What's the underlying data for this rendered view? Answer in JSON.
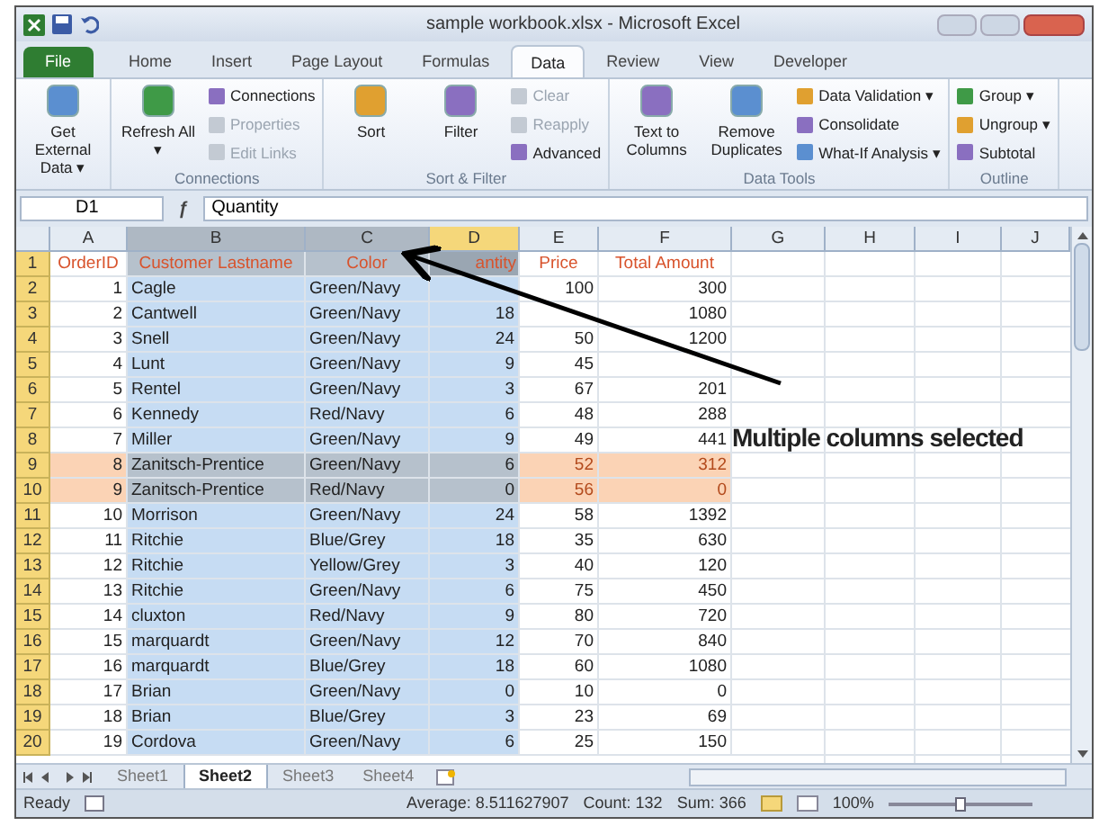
{
  "window": {
    "title": "sample workbook.xlsx - Microsoft Excel"
  },
  "ribbon_tabs": [
    {
      "label": "File",
      "kind": "file",
      "selected": false
    },
    {
      "label": "Home",
      "kind": "tab",
      "selected": false
    },
    {
      "label": "Insert",
      "kind": "tab",
      "selected": false
    },
    {
      "label": "Page Layout",
      "kind": "tab",
      "selected": false
    },
    {
      "label": "Formulas",
      "kind": "tab",
      "selected": false
    },
    {
      "label": "Data",
      "kind": "tab",
      "selected": true
    },
    {
      "label": "Review",
      "kind": "tab",
      "selected": false
    },
    {
      "label": "View",
      "kind": "tab",
      "selected": false
    },
    {
      "label": "Developer",
      "kind": "tab",
      "selected": false
    }
  ],
  "ribbon_groups": [
    {
      "items": [
        {
          "label": "Get External Data ▾",
          "kind": "large",
          "disabled": false
        }
      ]
    },
    {
      "name": "Connections",
      "items": [
        {
          "label": "Refresh All ▾",
          "kind": "large",
          "disabled": false
        },
        {
          "label": "Connections",
          "kind": "small",
          "disabled": false
        },
        {
          "label": "Properties",
          "kind": "small",
          "disabled": true
        },
        {
          "label": "Edit Links",
          "kind": "small",
          "disabled": true
        }
      ]
    },
    {
      "name": "Sort & Filter",
      "items": [
        {
          "label": "Sort",
          "kind": "large",
          "disabled": false
        },
        {
          "label": "Filter",
          "kind": "large",
          "disabled": false
        },
        {
          "label": "Clear",
          "kind": "small",
          "disabled": true
        },
        {
          "label": "Reapply",
          "kind": "small",
          "disabled": true
        },
        {
          "label": "Advanced",
          "kind": "small",
          "disabled": false
        }
      ]
    },
    {
      "name": "Data Tools",
      "items": [
        {
          "label": "Text to Columns",
          "kind": "large",
          "disabled": false
        },
        {
          "label": "Remove Duplicates",
          "kind": "large",
          "disabled": false
        },
        {
          "label": "Data Validation ▾",
          "kind": "small",
          "disabled": false
        },
        {
          "label": "Consolidate",
          "kind": "small",
          "disabled": false
        },
        {
          "label": "What-If Analysis ▾",
          "kind": "small",
          "disabled": false
        }
      ]
    },
    {
      "name": "Outline",
      "items": [
        {
          "label": "Group ▾",
          "kind": "small",
          "disabled": false
        },
        {
          "label": "Ungroup ▾",
          "kind": "small",
          "disabled": false
        },
        {
          "label": "Subtotal",
          "kind": "small",
          "disabled": false
        }
      ]
    }
  ],
  "name_box": "D1",
  "function_button": "ƒ",
  "formula": "Quantity",
  "columns": [
    {
      "label": "A",
      "selected": false,
      "active": false
    },
    {
      "label": "B",
      "selected": true,
      "active": false
    },
    {
      "label": "C",
      "selected": true,
      "active": false
    },
    {
      "label": "D",
      "selected": true,
      "active": true
    },
    {
      "label": "E",
      "selected": false,
      "active": false
    },
    {
      "label": "F",
      "selected": false,
      "active": false
    },
    {
      "label": "G",
      "selected": false,
      "active": false
    },
    {
      "label": "H",
      "selected": false,
      "active": false
    },
    {
      "label": "I",
      "selected": false,
      "active": false
    },
    {
      "label": "J",
      "selected": false,
      "active": false
    }
  ],
  "rows": [
    {
      "number": "1",
      "kind": "header",
      "highlighted": false,
      "cells": [
        "OrderID",
        "Customer Lastname",
        "Color",
        "antity",
        "Price",
        "Total Amount"
      ]
    },
    {
      "number": "2",
      "kind": "data",
      "highlighted": false,
      "cells": [
        "1",
        "Cagle",
        "Green/Navy",
        null,
        "100",
        "300"
      ]
    },
    {
      "number": "3",
      "kind": "data",
      "highlighted": false,
      "cells": [
        "2",
        "Cantwell",
        "Green/Navy",
        "18",
        null,
        "1080"
      ]
    },
    {
      "number": "4",
      "kind": "data",
      "highlighted": false,
      "cells": [
        "3",
        "Snell",
        "Green/Navy",
        "24",
        "50",
        "1200"
      ]
    },
    {
      "number": "5",
      "kind": "data",
      "highlighted": false,
      "cells": [
        "4",
        "Lunt",
        "Green/Navy",
        "9",
        "45",
        null
      ]
    },
    {
      "number": "6",
      "kind": "data",
      "highlighted": false,
      "cells": [
        "5",
        "Rentel",
        "Green/Navy",
        "3",
        "67",
        "201"
      ]
    },
    {
      "number": "7",
      "kind": "data",
      "highlighted": false,
      "cells": [
        "6",
        "Kennedy",
        "Red/Navy",
        "6",
        "48",
        "288"
      ]
    },
    {
      "number": "8",
      "kind": "data",
      "highlighted": false,
      "cells": [
        "7",
        "Miller",
        "Green/Navy",
        "9",
        "49",
        "441"
      ]
    },
    {
      "number": "9",
      "kind": "data",
      "highlighted": true,
      "cells": [
        "8",
        "Zanitsch-Prentice",
        "Green/Navy",
        "6",
        "52",
        "312"
      ]
    },
    {
      "number": "10",
      "kind": "data",
      "highlighted": true,
      "cells": [
        "9",
        "Zanitsch-Prentice",
        "Red/Navy",
        "0",
        "56",
        "0"
      ]
    },
    {
      "number": "11",
      "kind": "data",
      "highlighted": false,
      "cells": [
        "10",
        "Morrison",
        "Green/Navy",
        "24",
        "58",
        "1392"
      ]
    },
    {
      "number": "12",
      "kind": "data",
      "highlighted": false,
      "cells": [
        "11",
        "Ritchie",
        "Blue/Grey",
        "18",
        "35",
        "630"
      ]
    },
    {
      "number": "13",
      "kind": "data",
      "highlighted": false,
      "cells": [
        "12",
        "Ritchie",
        "Yellow/Grey",
        "3",
        "40",
        "120"
      ]
    },
    {
      "number": "14",
      "kind": "data",
      "highlighted": false,
      "cells": [
        "13",
        "Ritchie",
        "Green/Navy",
        "6",
        "75",
        "450"
      ]
    },
    {
      "number": "15",
      "kind": "data",
      "highlighted": false,
      "cells": [
        "14",
        "cluxton",
        "Red/Navy",
        "9",
        "80",
        "720"
      ]
    },
    {
      "number": "16",
      "kind": "data",
      "highlighted": false,
      "cells": [
        "15",
        "marquardt",
        "Green/Navy",
        "12",
        "70",
        "840"
      ]
    },
    {
      "number": "17",
      "kind": "data",
      "highlighted": false,
      "cells": [
        "16",
        "marquardt",
        "Blue/Grey",
        "18",
        "60",
        "1080"
      ]
    },
    {
      "number": "18",
      "kind": "data",
      "highlighted": false,
      "cells": [
        "17",
        "Brian",
        "Green/Navy",
        "0",
        "10",
        "0"
      ]
    },
    {
      "number": "19",
      "kind": "data",
      "highlighted": false,
      "cells": [
        "18",
        "Brian",
        "Blue/Grey",
        "3",
        "23",
        "69"
      ]
    },
    {
      "number": "20",
      "kind": "data",
      "highlighted": false,
      "cells": [
        "19",
        "Cordova",
        "Green/Navy",
        "6",
        "25",
        "150"
      ]
    }
  ],
  "annotation": "Multiple columns selected",
  "sheet_tabs": [
    {
      "label": "Sheet1",
      "selected": false
    },
    {
      "label": "Sheet2",
      "selected": true
    },
    {
      "label": "Sheet3",
      "selected": false
    },
    {
      "label": "Sheet4",
      "selected": false
    }
  ],
  "status_bar": {
    "mode": "Ready",
    "average": "Average: 8.511627907",
    "count": "Count: 132",
    "sum": "Sum: 366",
    "zoom": "100%",
    "zoom_slider": {
      "level": 0.5
    }
  }
}
